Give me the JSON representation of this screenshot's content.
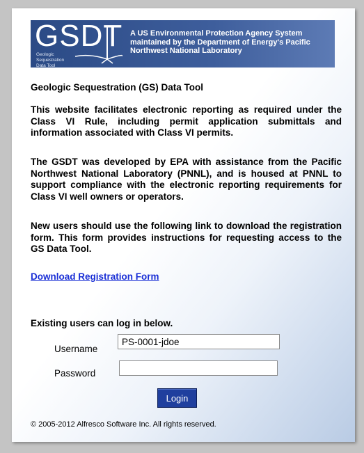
{
  "banner": {
    "logo_text": "GSDT",
    "logo_subtitle": "Geologic Sequestration Data Tool",
    "description": "A US Environmental Protection Agency System maintained by the Department of Energy's Pacific Northwest National Laboratory"
  },
  "main": {
    "heading": "Geologic Sequestration (GS) Data Tool",
    "paragraph1": "This website facilitates electronic reporting as required under the Class VI Rule, including permit application submittals and information associated with Class VI permits.",
    "paragraph2": "The GSDT was developed by EPA with assistance from the Pacific Northwest National Laboratory (PNNL), and is housed at PNNL to support compliance with the electronic reporting requirements for Class VI well owners or operators.",
    "paragraph3": "New users should use the following link to download the registration form. This form provides instructions for requesting access to the GS Data Tool.",
    "download_link": "Download Registration Form",
    "existing_users": "Existing users can log in below."
  },
  "login": {
    "username_label": "Username",
    "username_value": "PS-0001-jdoe",
    "password_label": "Password",
    "password_value": "",
    "button_label": "Login"
  },
  "footer": {
    "copyright": "© 2005-2012 Alfresco Software Inc. All rights reserved."
  },
  "colors": {
    "banner": "#2b4a85",
    "link": "#1a2fd6",
    "button": "#1f3f9e"
  }
}
